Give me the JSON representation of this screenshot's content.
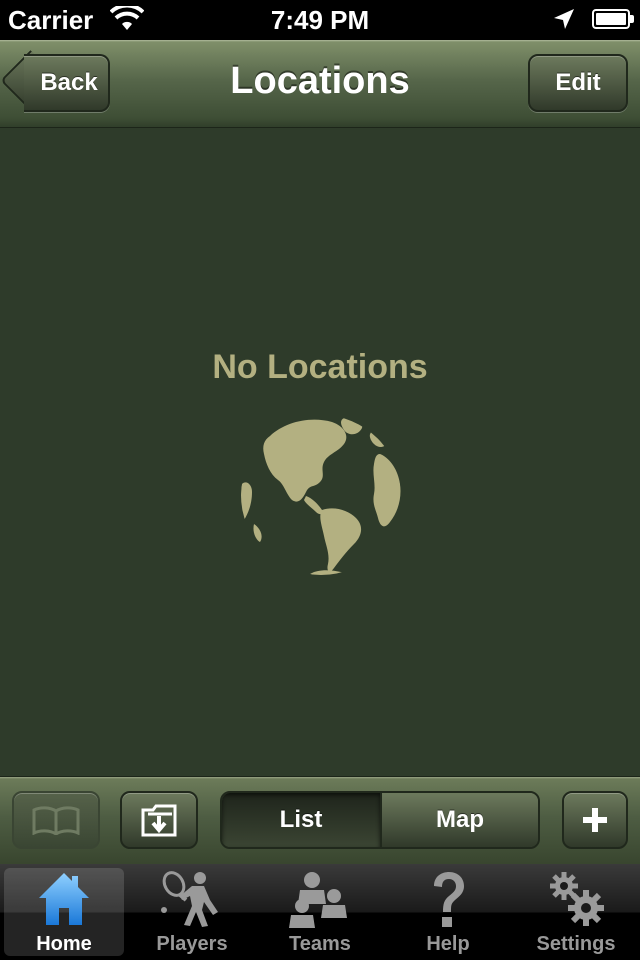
{
  "status_bar": {
    "carrier": "Carrier",
    "time": "7:49 PM"
  },
  "nav": {
    "back_label": "Back",
    "title": "Locations",
    "edit_label": "Edit"
  },
  "main": {
    "empty_message": "No Locations"
  },
  "toolbar": {
    "segment": {
      "list_label": "List",
      "map_label": "Map",
      "selected": "List"
    },
    "book_disabled": true
  },
  "tabs": [
    {
      "label": "Home",
      "icon": "home-icon",
      "selected": true
    },
    {
      "label": "Players",
      "icon": "tennis-player-icon",
      "selected": false
    },
    {
      "label": "Teams",
      "icon": "teams-icon",
      "selected": false
    },
    {
      "label": "Help",
      "icon": "help-icon",
      "selected": false
    },
    {
      "label": "Settings",
      "icon": "settings-icon",
      "selected": false
    }
  ],
  "colors": {
    "background": "#2e3b2a",
    "navbar": "#56664a",
    "empty_text": "#b3b081",
    "tab_selected_icon": "#3aa2ef"
  }
}
